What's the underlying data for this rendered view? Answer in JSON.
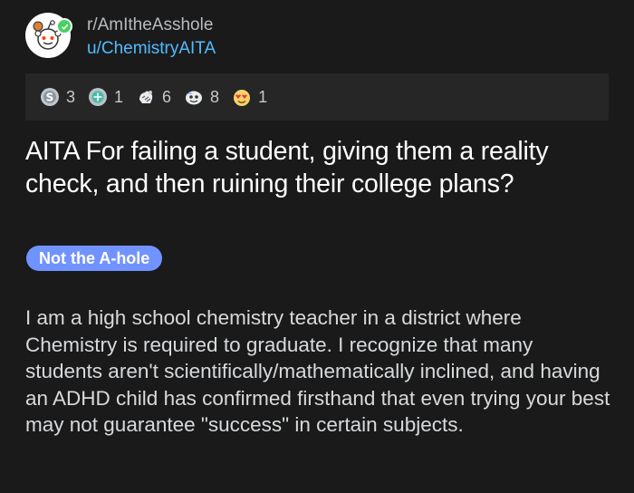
{
  "post": {
    "subreddit": "r/AmItheAsshole",
    "username": "u/ChemistryAITA",
    "title": "AITA For failing a student, giving them a reality check, and then ruining their college plans?",
    "flair": "Not the A-hole",
    "body": "I am a high school chemistry teacher in a district where Chemistry is required to graduate. I recognize that many students aren't scientifically/mathematically inclined, and having an ADHD child has confirmed firsthand that even trying your best may not guarantee \"success\" in certain subjects."
  },
  "awards": [
    {
      "icon": "silver-award-icon",
      "count": "3"
    },
    {
      "icon": "helpful-award-icon",
      "count": "1"
    },
    {
      "icon": "wholesome-award-icon",
      "count": "6"
    },
    {
      "icon": "ally-award-icon",
      "count": "8"
    },
    {
      "icon": "heart-eyes-award-icon",
      "count": "1"
    }
  ],
  "colors": {
    "background": "#1a1a1b",
    "username": "#4fbcff",
    "flair": "#7193ff",
    "award_bar": "#262627"
  }
}
